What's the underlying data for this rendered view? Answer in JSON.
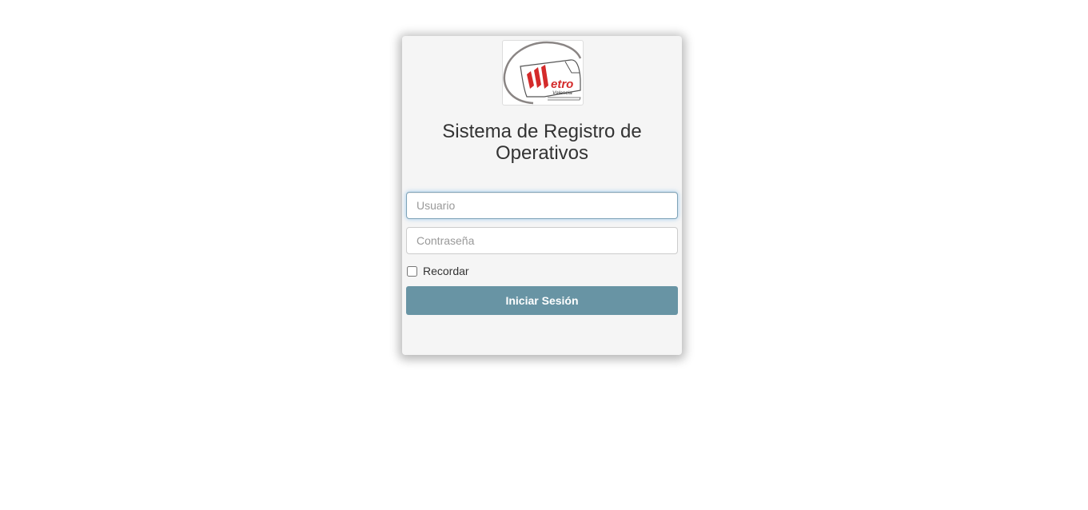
{
  "logo": {
    "text_main": "etro",
    "text_sub": "Valencia",
    "icon": "metro-valencia-logo"
  },
  "title": "Sistema de Registro de Operativos",
  "form": {
    "username_placeholder": "Usuario",
    "password_placeholder": "Contraseña",
    "remember_label": "Recordar",
    "submit_label": "Iniciar Sesión"
  },
  "colors": {
    "card_bg": "#f5f5f5",
    "button_bg": "#6894a4",
    "logo_red": "#d42a2a",
    "logo_gray": "#8a8584"
  }
}
